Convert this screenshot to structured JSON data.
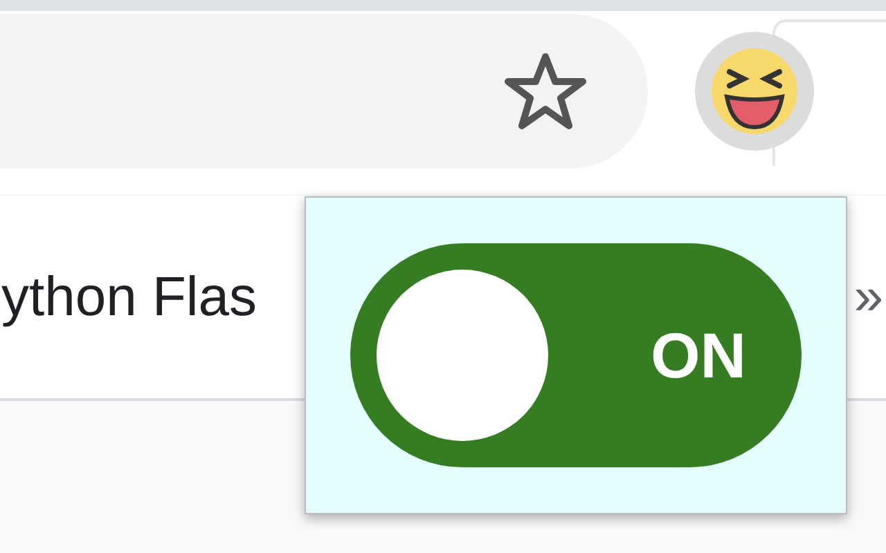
{
  "bookmarks_bar": {
    "item": "ython Flas",
    "overflow": "»"
  },
  "popup": {
    "toggle": {
      "on": true,
      "label": "ON"
    }
  }
}
